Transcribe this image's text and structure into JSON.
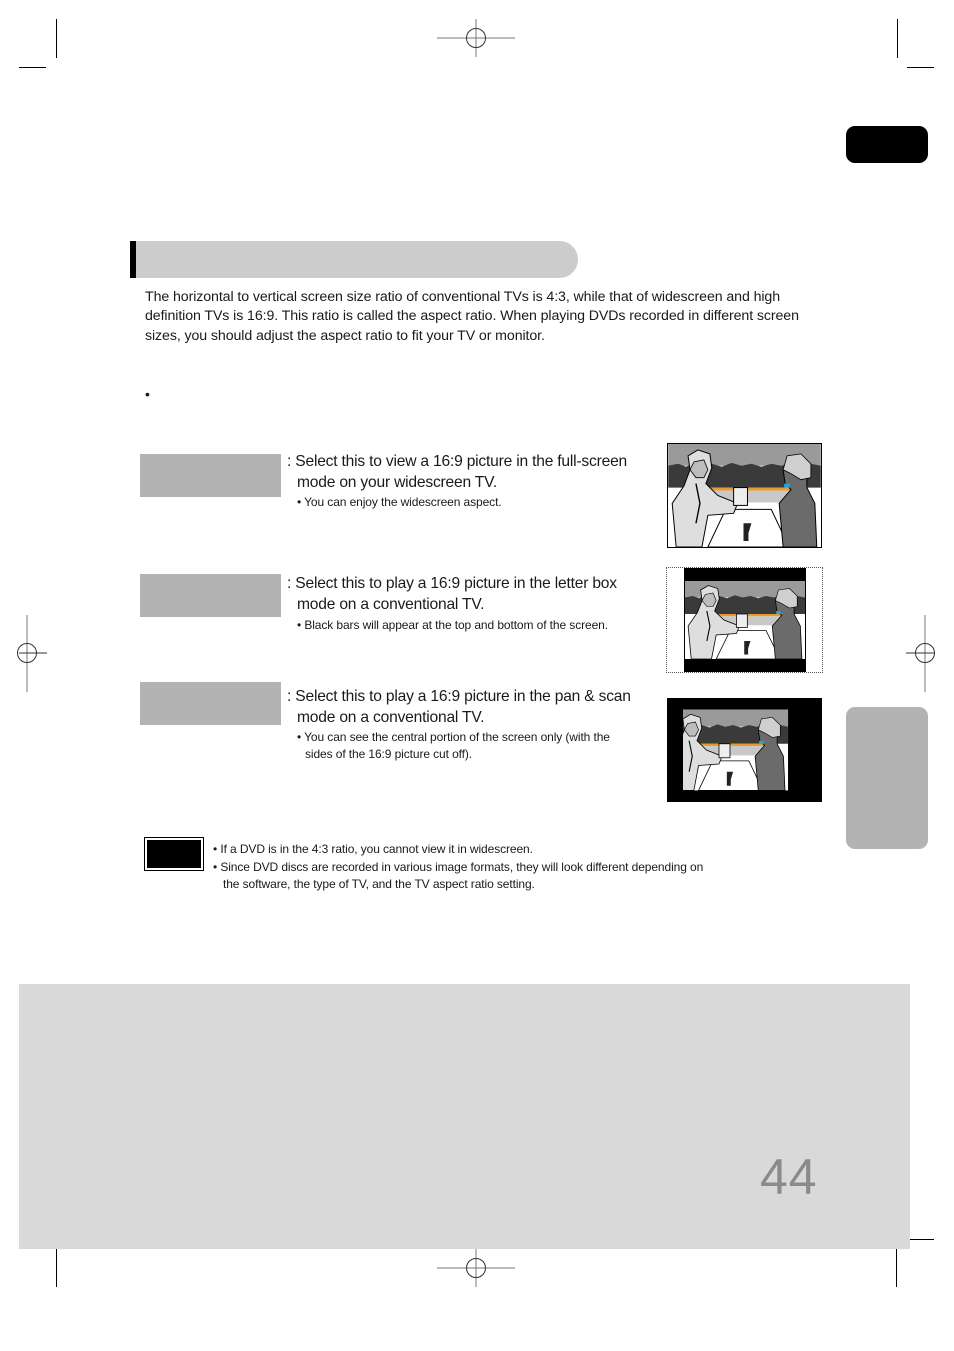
{
  "page": {
    "page_number": "44",
    "section_header_label": "",
    "intro_text": "The horizontal to vertical screen size ratio of conventional TVs is 4:3, while that of widescreen and high definition TVs is 16:9. This ratio is called the aspect ratio. When playing DVDs recorded in different screen sizes, you should adjust the aspect ratio to fit your TV or monitor.",
    "bullet_marker": "•"
  },
  "options": [
    {
      "label": "",
      "desc_line1": ": Select this to view a 16:9 picture in the full-screen",
      "desc_line2": "mode on your widescreen TV.",
      "note_line1": "• You can enjoy the widescreen aspect.",
      "note_line2": "",
      "illustration": "widescreen-16-9"
    },
    {
      "label": "",
      "desc_line1": ": Select this to play a 16:9 picture in the letter box",
      "desc_line2": "mode on a conventional TV.",
      "note_line1": "• Black bars will appear at the top and bottom of the screen.",
      "note_line2": "",
      "illustration": "letterbox-4-3"
    },
    {
      "label": "",
      "desc_line1": ": Select this to play a 16:9 picture in the pan & scan",
      "desc_line2": "mode on a conventional TV.",
      "note_line1": "• You can see the central portion of the screen only (with the",
      "note_line2": "sides of the 16:9 picture cut off).",
      "illustration": "pan-scan-4-3"
    }
  ],
  "note": {
    "badge_label": "",
    "items": [
      {
        "line1": "• If a DVD is in the 4:3 ratio, you cannot view it in widescreen.",
        "line2": ""
      },
      {
        "line1": "• Since DVD discs are recorded in various image formats, they will look different depending on",
        "line2": "the software, the type of TV, and the TV aspect ratio setting."
      }
    ]
  },
  "tabs": {
    "top_tab_label": "",
    "side_tab_label": ""
  },
  "colors": {
    "header_bg": "#cccccc",
    "label_bg": "#b3b3b3",
    "footer_bg": "#d9d9d9",
    "page_number": "#8a8a8a",
    "accent_blue": "#1fa6d8",
    "accent_orange": "#e89a2c"
  }
}
